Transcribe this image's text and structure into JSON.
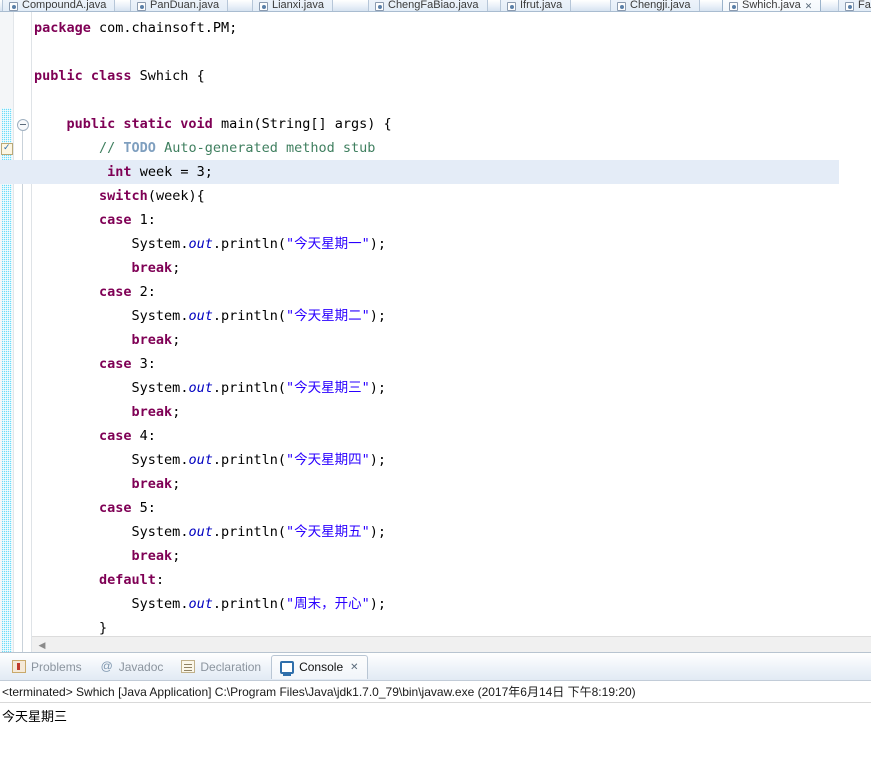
{
  "editor_tabs": [
    {
      "label": "CompoundA.java",
      "active": false,
      "closable": false
    },
    {
      "label": "PanDuan.java",
      "active": false,
      "closable": false
    },
    {
      "label": "Lianxi.java",
      "active": false,
      "closable": false
    },
    {
      "label": "ChengFaBiao.java",
      "active": false,
      "closable": false
    },
    {
      "label": "Ifrut.java",
      "active": false,
      "closable": false
    },
    {
      "label": "Chengji.java",
      "active": false,
      "closable": false
    },
    {
      "label": "Swhich.java",
      "active": true,
      "closable": true
    },
    {
      "label": "Fa",
      "active": false,
      "closable": false
    }
  ],
  "tab_close_glyph": "✕",
  "code": {
    "lines": [
      {
        "indent": 0,
        "tokens": [
          {
            "t": "package ",
            "c": "kw"
          },
          {
            "t": "com.chainsoft.PM;",
            "c": "pln"
          }
        ]
      },
      {
        "indent": 0,
        "tokens": []
      },
      {
        "indent": 0,
        "tokens": [
          {
            "t": "public class ",
            "c": "kw"
          },
          {
            "t": "Swhich {",
            "c": "pln"
          }
        ]
      },
      {
        "indent": 0,
        "tokens": []
      },
      {
        "indent": 1,
        "tokens": [
          {
            "t": "public static void ",
            "c": "kw"
          },
          {
            "t": "main(String[] args) {",
            "c": "pln"
          }
        ]
      },
      {
        "indent": 2,
        "tokens": [
          {
            "t": "// ",
            "c": "cmt"
          },
          {
            "t": "TODO",
            "c": "cmt-tag"
          },
          {
            "t": " Auto-generated method stub",
            "c": "cmt"
          }
        ]
      },
      {
        "indent": 2,
        "highlight": true,
        "tokens": [
          {
            "t": " ",
            "c": "pln"
          },
          {
            "t": "int ",
            "c": "kw"
          },
          {
            "t": "week = 3;",
            "c": "pln"
          }
        ]
      },
      {
        "indent": 2,
        "tokens": [
          {
            "t": "switch",
            "c": "kw"
          },
          {
            "t": "(week){",
            "c": "pln"
          }
        ]
      },
      {
        "indent": 2,
        "tokens": [
          {
            "t": "case ",
            "c": "kw"
          },
          {
            "t": "1:",
            "c": "pln"
          }
        ]
      },
      {
        "indent": 3,
        "tokens": [
          {
            "t": "System.",
            "c": "pln"
          },
          {
            "t": "out",
            "c": "fld"
          },
          {
            "t": ".println(",
            "c": "pln"
          },
          {
            "t": "\"今天星期一\"",
            "c": "str"
          },
          {
            "t": ");",
            "c": "pln"
          }
        ]
      },
      {
        "indent": 3,
        "tokens": [
          {
            "t": "break",
            "c": "kw"
          },
          {
            "t": ";",
            "c": "pln"
          }
        ]
      },
      {
        "indent": 2,
        "tokens": [
          {
            "t": "case ",
            "c": "kw"
          },
          {
            "t": "2:",
            "c": "pln"
          }
        ]
      },
      {
        "indent": 3,
        "tokens": [
          {
            "t": "System.",
            "c": "pln"
          },
          {
            "t": "out",
            "c": "fld"
          },
          {
            "t": ".println(",
            "c": "pln"
          },
          {
            "t": "\"今天星期二\"",
            "c": "str"
          },
          {
            "t": ");",
            "c": "pln"
          }
        ]
      },
      {
        "indent": 3,
        "tokens": [
          {
            "t": "break",
            "c": "kw"
          },
          {
            "t": ";",
            "c": "pln"
          }
        ]
      },
      {
        "indent": 2,
        "tokens": [
          {
            "t": "case ",
            "c": "kw"
          },
          {
            "t": "3:",
            "c": "pln"
          }
        ]
      },
      {
        "indent": 3,
        "tokens": [
          {
            "t": "System.",
            "c": "pln"
          },
          {
            "t": "out",
            "c": "fld"
          },
          {
            "t": ".println(",
            "c": "pln"
          },
          {
            "t": "\"今天星期三\"",
            "c": "str"
          },
          {
            "t": ");",
            "c": "pln"
          }
        ]
      },
      {
        "indent": 3,
        "tokens": [
          {
            "t": "break",
            "c": "kw"
          },
          {
            "t": ";",
            "c": "pln"
          }
        ]
      },
      {
        "indent": 2,
        "tokens": [
          {
            "t": "case ",
            "c": "kw"
          },
          {
            "t": "4:",
            "c": "pln"
          }
        ]
      },
      {
        "indent": 3,
        "tokens": [
          {
            "t": "System.",
            "c": "pln"
          },
          {
            "t": "out",
            "c": "fld"
          },
          {
            "t": ".println(",
            "c": "pln"
          },
          {
            "t": "\"今天星期四\"",
            "c": "str"
          },
          {
            "t": ");",
            "c": "pln"
          }
        ]
      },
      {
        "indent": 3,
        "tokens": [
          {
            "t": "break",
            "c": "kw"
          },
          {
            "t": ";",
            "c": "pln"
          }
        ]
      },
      {
        "indent": 2,
        "tokens": [
          {
            "t": "case ",
            "c": "kw"
          },
          {
            "t": "5:",
            "c": "pln"
          }
        ]
      },
      {
        "indent": 3,
        "tokens": [
          {
            "t": "System.",
            "c": "pln"
          },
          {
            "t": "out",
            "c": "fld"
          },
          {
            "t": ".println(",
            "c": "pln"
          },
          {
            "t": "\"今天星期五\"",
            "c": "str"
          },
          {
            "t": ");",
            "c": "pln"
          }
        ]
      },
      {
        "indent": 3,
        "tokens": [
          {
            "t": "break",
            "c": "kw"
          },
          {
            "t": ";",
            "c": "pln"
          }
        ]
      },
      {
        "indent": 2,
        "tokens": [
          {
            "t": "default",
            "c": "kw"
          },
          {
            "t": ":",
            "c": "pln"
          }
        ]
      },
      {
        "indent": 3,
        "tokens": [
          {
            "t": "System.",
            "c": "pln"
          },
          {
            "t": "out",
            "c": "fld"
          },
          {
            "t": ".println(",
            "c": "pln"
          },
          {
            "t": "\"周末，开心\"",
            "c": "str"
          },
          {
            "t": ");",
            "c": "pln"
          }
        ]
      },
      {
        "indent": 2,
        "tokens": [
          {
            "t": "}",
            "c": "pln"
          }
        ]
      }
    ]
  },
  "scroll": {
    "left_arrow": "◀"
  },
  "bottom_view": {
    "tabs": [
      {
        "label": "Problems",
        "icon": "problems-icon",
        "active": false,
        "closable": false
      },
      {
        "label": "Javadoc",
        "icon": "javadoc-icon",
        "active": false,
        "closable": false
      },
      {
        "label": "Declaration",
        "icon": "declaration-icon",
        "active": false,
        "closable": false
      },
      {
        "label": "Console",
        "icon": "console-icon",
        "active": true,
        "closable": true
      }
    ],
    "close_glyph": "✕",
    "javadoc_glyph": "@",
    "status_line": "<terminated> Swhich [Java Application] C:\\Program Files\\Java\\jdk1.7.0_79\\bin\\javaw.exe (2017年6月14日 下午8:19:20)",
    "output": "今天星期三"
  },
  "colors": {
    "keyword": "#7f0055",
    "string": "#2a00ff",
    "comment": "#3f7f5f",
    "field": "#0000c0",
    "highlight_line": "#e4ecf7",
    "changebar": "#2e9bdc"
  }
}
